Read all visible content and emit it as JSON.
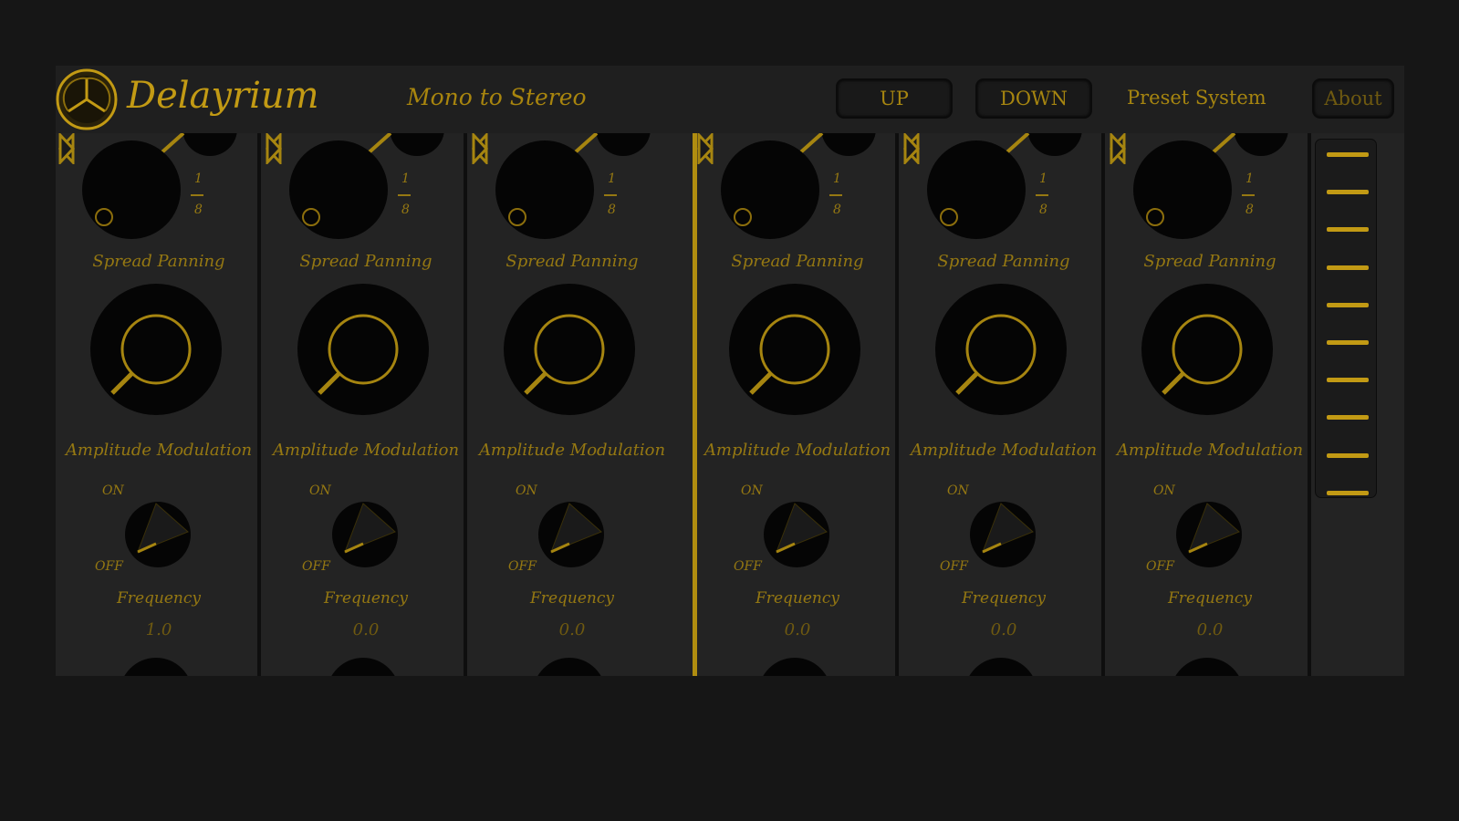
{
  "app": {
    "name": "Delayrium",
    "mode": "Mono to Stereo"
  },
  "header": {
    "up_label": "UP",
    "down_label": "DOWN",
    "preset_label": "Preset System",
    "about_label": "About"
  },
  "strips": [
    {
      "time_fraction_num": "1",
      "time_fraction_den": "8",
      "spread_label": "Spread Panning",
      "am_label": "Amplitude Modulation",
      "on_label": "ON",
      "off_label": "OFF",
      "am_state": "off",
      "frequency_label": "Frequency",
      "frequency_value": "1.0"
    },
    {
      "time_fraction_num": "1",
      "time_fraction_den": "8",
      "spread_label": "Spread Panning",
      "am_label": "Amplitude Modulation",
      "on_label": "ON",
      "off_label": "OFF",
      "am_state": "off",
      "frequency_label": "Frequency",
      "frequency_value": "0.0"
    },
    {
      "time_fraction_num": "1",
      "time_fraction_den": "8",
      "spread_label": "Spread Panning",
      "am_label": "Amplitude Modulation",
      "on_label": "ON",
      "off_label": "OFF",
      "am_state": "off",
      "frequency_label": "Frequency",
      "frequency_value": "0.0"
    },
    {
      "time_fraction_num": "1",
      "time_fraction_den": "8",
      "spread_label": "Spread Panning",
      "am_label": "Amplitude Modulation",
      "on_label": "ON",
      "off_label": "OFF",
      "am_state": "off",
      "frequency_label": "Frequency",
      "frequency_value": "0.0"
    },
    {
      "time_fraction_num": "1",
      "time_fraction_den": "8",
      "spread_label": "Spread Panning",
      "am_label": "Amplitude Modulation",
      "on_label": "ON",
      "off_label": "OFF",
      "am_state": "off",
      "frequency_label": "Frequency",
      "frequency_value": "0.0"
    },
    {
      "time_fraction_num": "1",
      "time_fraction_den": "8",
      "spread_label": "Spread Panning",
      "am_label": "Amplitude Modulation",
      "on_label": "ON",
      "off_label": "OFF",
      "am_state": "off",
      "frequency_label": "Frequency",
      "frequency_value": "0.0"
    }
  ],
  "colors": {
    "accent": "#c29a14",
    "label": "#957812",
    "knob": "#050505",
    "panel": "#232323",
    "background": "#161616"
  },
  "icons": {
    "logo": "tri-circle-logo-icon",
    "left_arrow": "triangle-left-icon",
    "right_arrow": "triangle-right-icon"
  }
}
